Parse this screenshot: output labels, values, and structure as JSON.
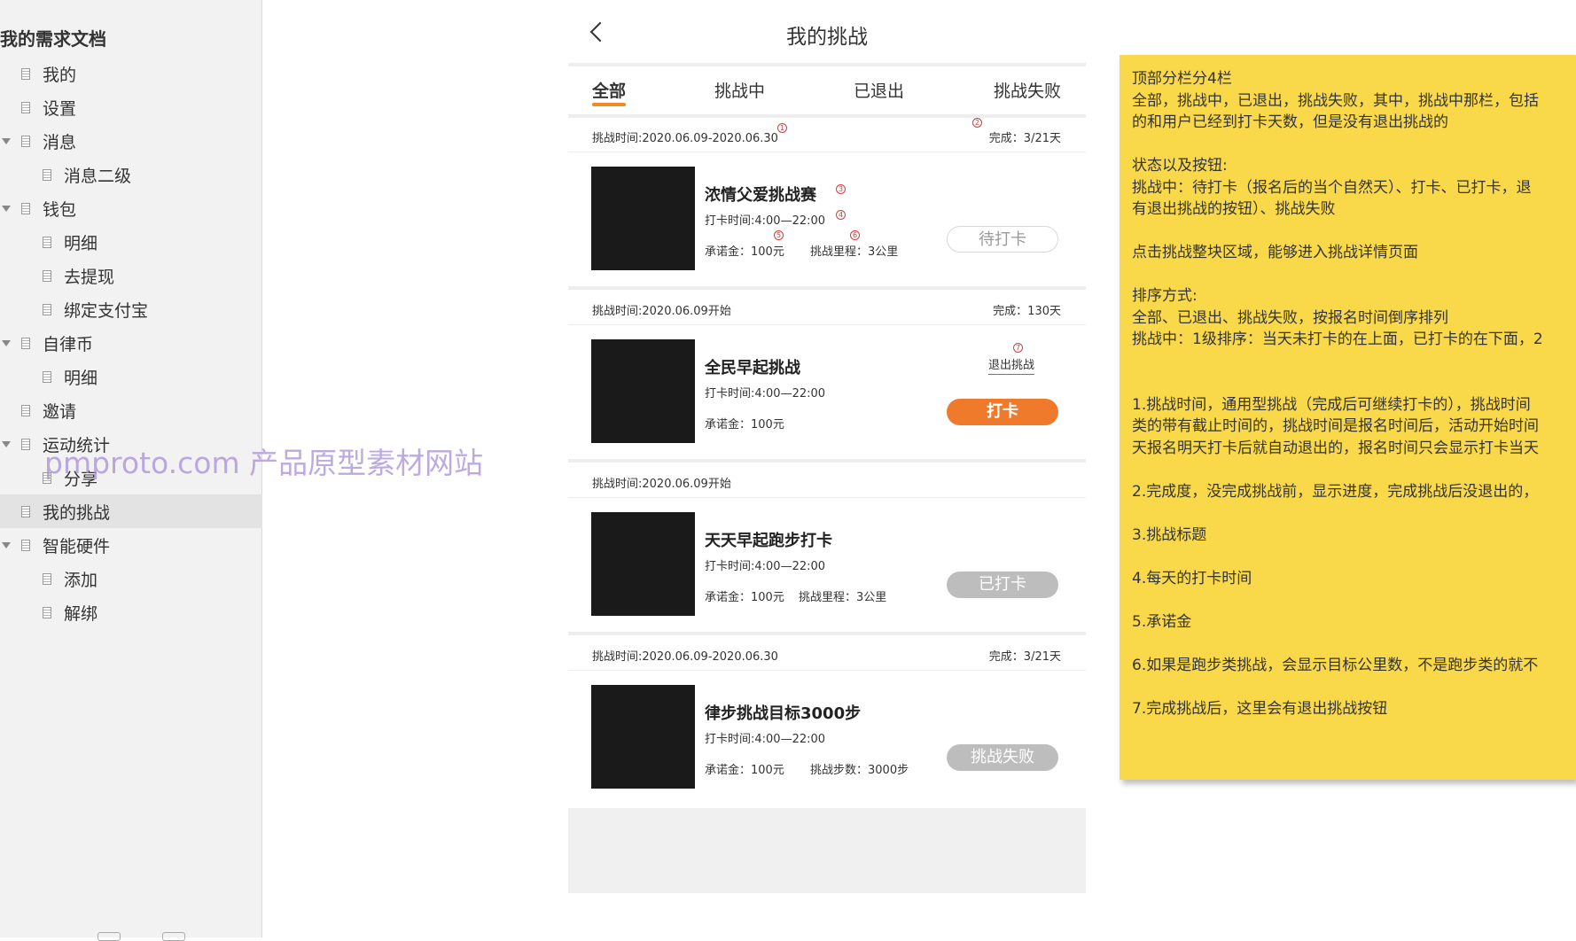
{
  "sidebar": {
    "title": "我的需求文档",
    "items": [
      {
        "label": "我的",
        "level": 1,
        "expanded": false,
        "has_children": false,
        "selected": false
      },
      {
        "label": "设置",
        "level": 1,
        "expanded": false,
        "has_children": false,
        "selected": false
      },
      {
        "label": "消息",
        "level": 1,
        "expanded": true,
        "has_children": true,
        "selected": false
      },
      {
        "label": "消息二级",
        "level": 2,
        "expanded": false,
        "has_children": false,
        "selected": false
      },
      {
        "label": "钱包",
        "level": 1,
        "expanded": true,
        "has_children": true,
        "selected": false
      },
      {
        "label": "明细",
        "level": 2,
        "expanded": false,
        "has_children": false,
        "selected": false
      },
      {
        "label": "去提现",
        "level": 2,
        "expanded": false,
        "has_children": false,
        "selected": false
      },
      {
        "label": "绑定支付宝",
        "level": 2,
        "expanded": false,
        "has_children": false,
        "selected": false
      },
      {
        "label": "自律币",
        "level": 1,
        "expanded": true,
        "has_children": true,
        "selected": false
      },
      {
        "label": "明细",
        "level": 2,
        "expanded": false,
        "has_children": false,
        "selected": false
      },
      {
        "label": "邀请",
        "level": 1,
        "expanded": false,
        "has_children": false,
        "selected": false
      },
      {
        "label": "运动统计",
        "level": 1,
        "expanded": true,
        "has_children": true,
        "selected": false
      },
      {
        "label": "分享",
        "level": 2,
        "expanded": false,
        "has_children": false,
        "selected": false
      },
      {
        "label": "我的挑战",
        "level": 1,
        "expanded": false,
        "has_children": false,
        "selected": true
      },
      {
        "label": "智能硬件",
        "level": 1,
        "expanded": true,
        "has_children": true,
        "selected": false
      },
      {
        "label": "添加",
        "level": 2,
        "expanded": false,
        "has_children": false,
        "selected": false
      },
      {
        "label": "解绑",
        "level": 2,
        "expanded": false,
        "has_children": false,
        "selected": false
      }
    ]
  },
  "watermark": "pmproto.com 产品原型素材网站",
  "phone": {
    "title": "我的挑战",
    "tabs": [
      {
        "label": "全部",
        "active": true
      },
      {
        "label": "挑战中",
        "active": false
      },
      {
        "label": "已退出",
        "active": false
      },
      {
        "label": "挑战失败",
        "active": false
      }
    ],
    "cards": [
      {
        "time_range": "挑战时间:2020.06.09-2020.06.30",
        "progress": "完成：3/21天",
        "title": "浓情父爱挑战赛",
        "checkin_time": "打卡时间:4:00—22:00",
        "deposit": "承诺金：100元",
        "extra": "挑战里程：3公里",
        "button": {
          "label": "待打卡",
          "style": "outline"
        },
        "quit_link": ""
      },
      {
        "time_range": "挑战时间:2020.06.09开始",
        "progress": "完成：130天",
        "title": "全民早起挑战",
        "checkin_time": "打卡时间:4:00—22:00",
        "deposit": "承诺金：100元",
        "extra": "",
        "button": {
          "label": "打卡",
          "style": "orange"
        },
        "quit_link": "退出挑战"
      },
      {
        "time_range": "挑战时间:2020.06.09开始",
        "progress": "",
        "title": "天天早起跑步打卡",
        "checkin_time": "打卡时间:4:00—22:00",
        "deposit": "承诺金：100元",
        "extra": "挑战里程：3公里",
        "button": {
          "label": "已打卡",
          "style": "gray"
        },
        "quit_link": ""
      },
      {
        "time_range": "挑战时间:2020.06.09-2020.06.30",
        "progress": "完成：3/21天",
        "title": "律步挑战目标3000步",
        "checkin_time": "打卡时间:4:00—22:00",
        "deposit": "承诺金：100元",
        "extra": "挑战步数：3000步",
        "button": {
          "label": "挑战失败",
          "style": "gray"
        },
        "quit_link": ""
      }
    ],
    "markers": [
      "1",
      "2",
      "3",
      "4",
      "5",
      "6",
      "7"
    ]
  },
  "note": {
    "lines": [
      "顶部分栏分4栏",
      "全部，挑战中，已退出，挑战失败，其中，挑战中那栏，包括",
      "的和用户已经到打卡天数，但是没有退出挑战的",
      "",
      "状态以及按钮:",
      "挑战中：待打卡（报名后的当个自然天）、打卡、已打卡，退",
      "有退出挑战的按钮）、挑战失败",
      "",
      "点击挑战整块区域，能够进入挑战详情页面",
      "",
      "排序方式:",
      "全部、已退出、挑战失败，按报名时间倒序排列",
      "挑战中：1级排序：当天未打卡的在上面，已打卡的在下面，2",
      "",
      "",
      "1.挑战时间，通用型挑战（完成后可继续打卡的），挑战时间",
      "类的带有截止时间的，挑战时间是报名时间后，活动开始时间",
      "天报名明天打卡后就自动退出的，报名时间只会显示打卡当天",
      "",
      "2.完成度，没完成挑战前，显示进度，完成挑战后没退出的，",
      "",
      "3.挑战标题",
      "",
      "4.每天的打卡时间",
      "",
      "5.承诺金",
      "",
      "6.如果是跑步类挑战，会显示目标公里数，不是跑步类的就不",
      "",
      "7.完成挑战后，这里会有退出挑战按钮"
    ]
  },
  "colors": {
    "accent_orange": "#f07a2c",
    "tab_underline": "#f08a24",
    "note_yellow": "#f9d94a",
    "marker_red": "#d93a3a",
    "sidebar_bg": "#f2f2f2"
  },
  "icons": {
    "back": "chevron-left-icon",
    "doc": "document-icon",
    "expand": "caret-down-icon"
  }
}
